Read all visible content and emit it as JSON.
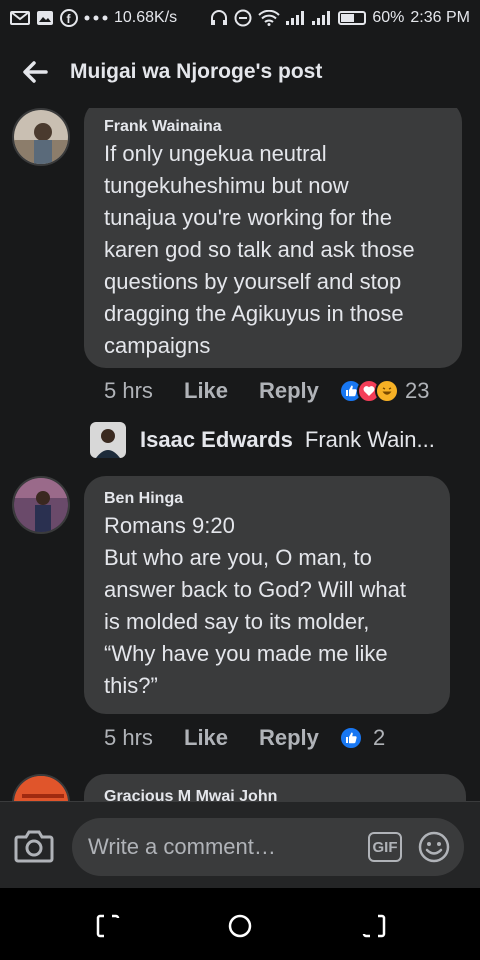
{
  "status_bar": {
    "speed": "10.68K/s",
    "battery": "60%",
    "battery_level": 0.6,
    "time": "2:36 PM"
  },
  "header": {
    "title": "Muigai wa Njoroge's post",
    "back_icon": "back-arrow-icon"
  },
  "comments": [
    {
      "author": "Frank Wainaina",
      "text": "If only ungekua neutral\ntungekuheshimu but now\ntunajua you're working for the\nkaren god so talk and ask those\nquestions by yourself and stop\ndragging the Agikuyus in those\ncampaigns",
      "time": "5 hrs",
      "like_label": "Like",
      "reply_label": "Reply",
      "reactions": [
        "like",
        "love",
        "haha"
      ],
      "reaction_count": "23",
      "reply_preview": {
        "name": "Isaac Edwards",
        "text": "Frank Wain..."
      }
    },
    {
      "author": "Ben Hinga",
      "text": "Romans 9:20\nBut who are you, O man, to\nanswer back to God? Will what\nis molded say to its molder,\n“Why have you made me like\nthis?”",
      "time": "5 hrs",
      "like_label": "Like",
      "reply_label": "Reply",
      "reactions": [
        "like"
      ],
      "reaction_count": "2"
    },
    {
      "author": "Gracious M Mwai John"
    }
  ],
  "composer": {
    "placeholder": "Write a comment…",
    "gif_label": "GIF"
  },
  "colors": {
    "background": "#18191a",
    "bubble": "#3a3b3c",
    "like_blue": "#1877f2",
    "love_red": "#f33e58",
    "haha_yellow": "#f7b125"
  }
}
